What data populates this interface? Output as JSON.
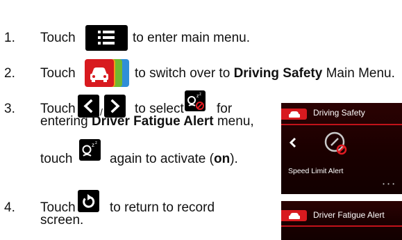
{
  "steps": [
    {
      "num": "1.",
      "parts": {
        "touch": "Touch",
        "rest": "to enter main menu."
      },
      "icon": "menu-list-icon"
    },
    {
      "num": "2.",
      "parts": {
        "touch": "Touch",
        "pre": "to switch over to ",
        "bold": "Driving Safety",
        "post": " Main Menu."
      },
      "icon": "car-menu-tab-icon"
    },
    {
      "num": "3.",
      "parts": {
        "touch": "Touch",
        "slash": "/",
        "to_select": "to select",
        "for": "for",
        "line2_pre": "entering ",
        "line2_bold": "Driver Fatigue Alert",
        "line2_post": " menu,",
        "line3_touch": "touch",
        "line3_pre": "again to activate (",
        "line3_bold": "on",
        "line3_post": ")."
      },
      "icon": "prev-next-arrows-icon"
    },
    {
      "num": "4.",
      "parts": {
        "touch": "Touch",
        "line1": "to return to record",
        "line2": "screen."
      },
      "icon": "return-icon"
    }
  ],
  "screens": {
    "screen1": {
      "title": "Driving Safety",
      "item_label": "Speed Limit Alert",
      "pager": "•   •   •"
    },
    "screen2": {
      "title": "Driver Fatigue Alert"
    }
  },
  "colors": {
    "red": "#d81a1f",
    "screen_bg": "#1f0102",
    "tab_orange": "#f39a18",
    "tab_green": "#71b830",
    "tab_blue": "#2f8ed8"
  }
}
